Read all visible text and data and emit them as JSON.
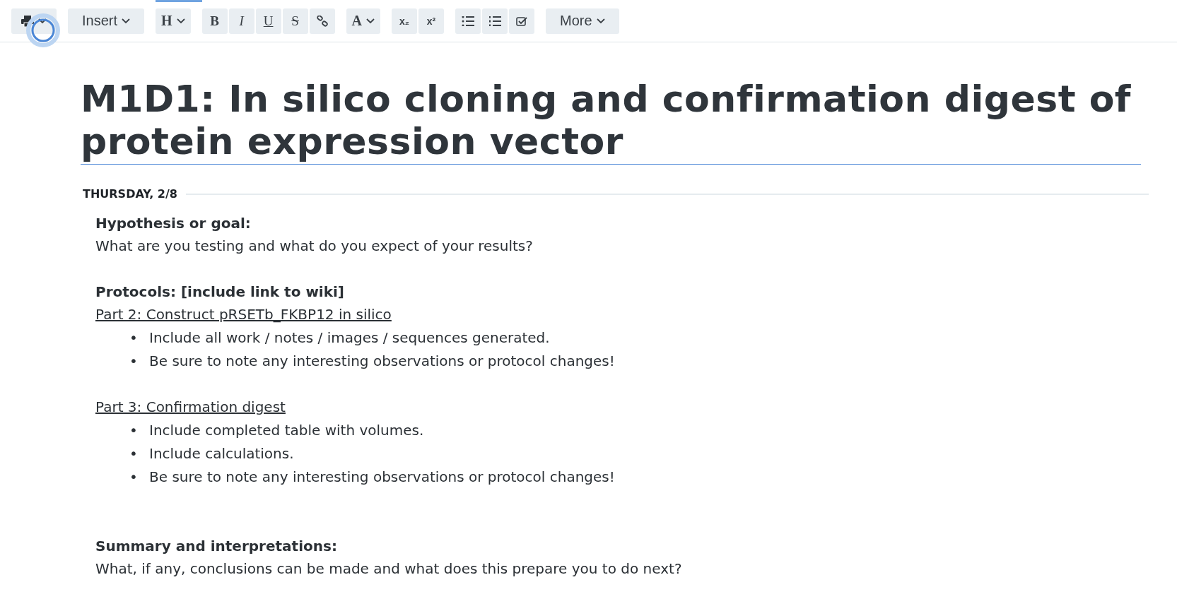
{
  "toolbar": {
    "groups": [
      {
        "items": [
          {
            "kind": "print"
          }
        ]
      },
      {
        "items": [
          {
            "kind": "menu",
            "label": "Insert"
          }
        ]
      },
      {
        "items": [
          {
            "kind": "serif-menu",
            "label": "H"
          }
        ]
      },
      {
        "items": [
          {
            "kind": "bold",
            "label": "B"
          },
          {
            "kind": "italic",
            "label": "I"
          },
          {
            "kind": "underline",
            "label": "U"
          },
          {
            "kind": "strike",
            "label": "S"
          },
          {
            "kind": "link"
          }
        ]
      },
      {
        "items": [
          {
            "kind": "serif-menu",
            "label": "A"
          }
        ]
      },
      {
        "items": [
          {
            "kind": "script",
            "label": "x₂"
          },
          {
            "kind": "script",
            "label": "x²"
          }
        ]
      },
      {
        "items": [
          {
            "kind": "bullets"
          },
          {
            "kind": "numbers"
          },
          {
            "kind": "checklist"
          }
        ]
      },
      {
        "items": [
          {
            "kind": "menu",
            "label": "More"
          }
        ]
      }
    ]
  },
  "page": {
    "title": "M1D1: In silico cloning and confirmation digest of protein expression vector",
    "date": "THURSDAY, 2/8",
    "sections": [
      {
        "heading": "Hypothesis or goal:",
        "text": "What are you testing and what do you expect of your results?"
      },
      {
        "heading": "Protocols: [include link to wiki]",
        "link": "Part 2: Construct pRSETb_FKBP12 in silico",
        "bullets": [
          {
            "marker": "•",
            "text": "Include all work / notes / images / sequences generated."
          },
          {
            "marker": "•",
            "text": "Be sure to note any interesting observations or protocol changes!"
          }
        ]
      },
      {
        "link": "Part 3: Confirmation digest",
        "bullets": [
          {
            "marker": "•",
            "text": "Include completed table with volumes."
          },
          {
            "marker": "•",
            "text": "Include calculations."
          },
          {
            "marker": "•",
            "text": "Be sure to note any interesting observations or protocol changes!"
          }
        ]
      },
      {
        "heading": "Summary and interpretations:",
        "text": "What, if any, conclusions can be made and what does this prepare you to do next?"
      }
    ]
  }
}
